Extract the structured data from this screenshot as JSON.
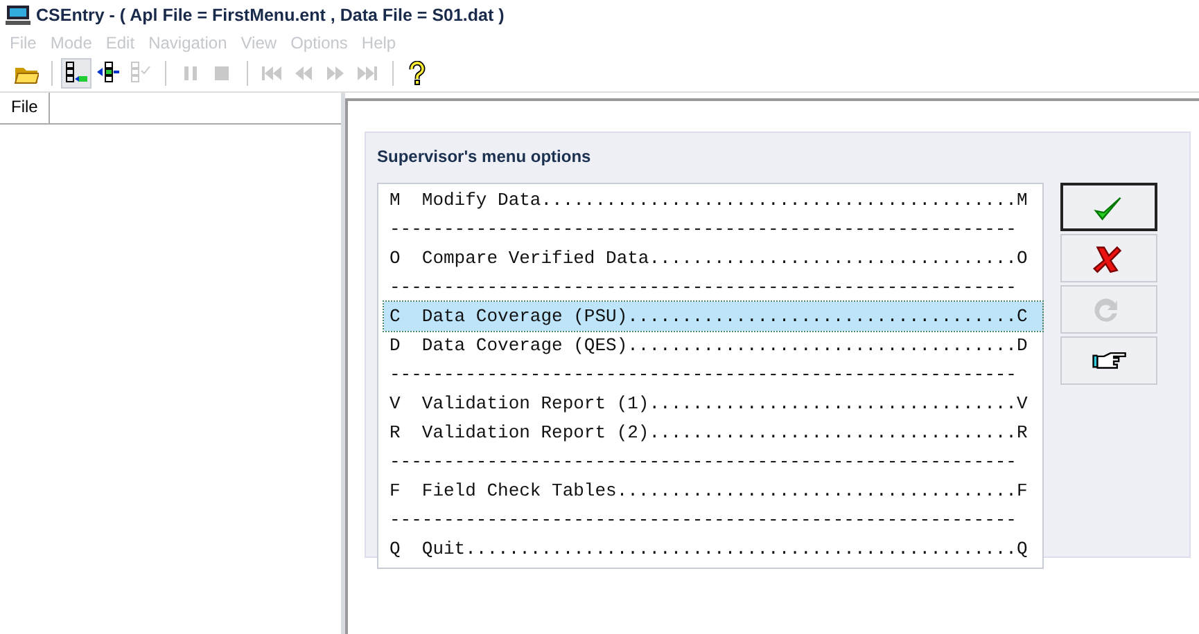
{
  "window": {
    "title": "CSEntry - ( Apl File = FirstMenu.ent , Data File = S01.dat )"
  },
  "menu_bar": [
    {
      "label": "File",
      "disabled": true
    },
    {
      "label": "Mode",
      "disabled": true
    },
    {
      "label": "Edit",
      "disabled": true
    },
    {
      "label": "Navigation",
      "disabled": true
    },
    {
      "label": "View",
      "disabled": true
    },
    {
      "label": "Options",
      "disabled": true
    },
    {
      "label": "Help",
      "disabled": true
    }
  ],
  "toolbar": [
    {
      "kind": "open",
      "disabled": false
    },
    {
      "kind": "sep"
    },
    {
      "kind": "add",
      "disabled": false,
      "pressed": true
    },
    {
      "kind": "modify",
      "disabled": false,
      "pressed": false
    },
    {
      "kind": "verify",
      "disabled": true,
      "pressed": false
    },
    {
      "kind": "sep"
    },
    {
      "kind": "pause",
      "disabled": true
    },
    {
      "kind": "stop",
      "disabled": true
    },
    {
      "kind": "sep"
    },
    {
      "kind": "first",
      "disabled": true
    },
    {
      "kind": "prev",
      "disabled": true
    },
    {
      "kind": "next",
      "disabled": true
    },
    {
      "kind": "last",
      "disabled": true
    },
    {
      "kind": "sep"
    },
    {
      "kind": "help",
      "disabled": false
    }
  ],
  "sidebar": {
    "tabs": [
      {
        "label": "File",
        "selected": true
      }
    ]
  },
  "dialog": {
    "title": "Supervisor's menu options",
    "lines": [
      {
        "kind": "option",
        "text": "M  Modify Data............................................M",
        "selected": false
      },
      {
        "kind": "separator",
        "text": "----------------------------------------------------------"
      },
      {
        "kind": "option",
        "text": "O  Compare Verified Data..................................O",
        "selected": false
      },
      {
        "kind": "separator",
        "text": "----------------------------------------------------------"
      },
      {
        "kind": "option",
        "text": "C  Data Coverage (PSU)....................................C",
        "selected": true
      },
      {
        "kind": "option",
        "text": "D  Data Coverage (QES)....................................D",
        "selected": false
      },
      {
        "kind": "separator",
        "text": "----------------------------------------------------------"
      },
      {
        "kind": "option",
        "text": "V  Validation Report (1)..................................V",
        "selected": false
      },
      {
        "kind": "option",
        "text": "R  Validation Report (2)..................................R",
        "selected": false
      },
      {
        "kind": "separator",
        "text": "----------------------------------------------------------"
      },
      {
        "kind": "option",
        "text": "F  Field Check Tables.....................................F",
        "selected": false
      },
      {
        "kind": "separator",
        "text": "----------------------------------------------------------"
      },
      {
        "kind": "option",
        "text": "Q  Quit...................................................Q",
        "selected": false
      }
    ],
    "buttons": [
      {
        "kind": "ok",
        "disabled": false,
        "default": true
      },
      {
        "kind": "cancel",
        "disabled": false,
        "default": false
      },
      {
        "kind": "refresh",
        "disabled": true,
        "default": false
      },
      {
        "kind": "point",
        "disabled": false,
        "default": false
      }
    ]
  }
}
